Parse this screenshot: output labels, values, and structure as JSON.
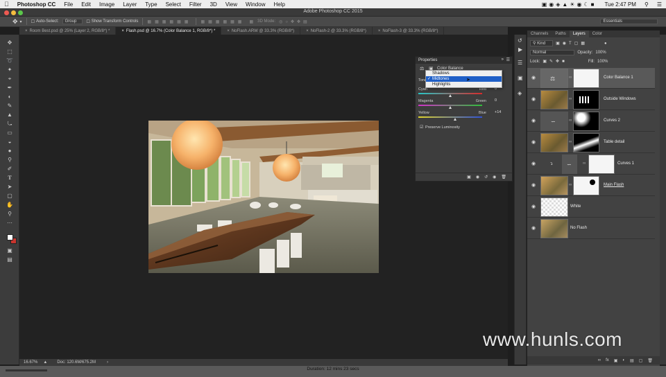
{
  "menubar": {
    "app_name": "Photoshop CC",
    "items": [
      "File",
      "Edit",
      "Image",
      "Layer",
      "Type",
      "Select",
      "Filter",
      "3D",
      "View",
      "Window",
      "Help"
    ],
    "clock": "Tue 2:47 PM"
  },
  "window_title": "Adobe Photoshop CC 2015",
  "options_bar": {
    "auto_select_label": "Auto-Select:",
    "auto_select_value": "Group",
    "show_transform_label": "Show Transform Controls",
    "mode_3d_label": "3D Mode:",
    "workspace": "Essentials"
  },
  "doc_tabs": [
    {
      "label": "Room Best.psd @ 25% (Layer 2, RGB/8*) *",
      "active": false
    },
    {
      "label": "Flash.psd @ 16.7% (Color Balance 1, RGB/8*) *",
      "active": true
    },
    {
      "label": "NoFlash.ARW @ 33.3% (RGB/8*)",
      "active": false
    },
    {
      "label": "NoFlash-2 @ 33.3% (RGB/8*)",
      "active": false
    },
    {
      "label": "NoFlash-3 @ 33.3% (RGB/8*)",
      "active": false
    }
  ],
  "status_bar": {
    "zoom": "16.67%",
    "doc_size": "Doc: 120.6M/675.2M"
  },
  "footer": {
    "duration": "Duration: 12 mins 23 secs"
  },
  "properties": {
    "panel_title": "Properties",
    "adjustment_title": "Color Balance",
    "tone_label": "Tone:",
    "tone_options": [
      "Shadows",
      "Midtones",
      "Highlights"
    ],
    "tone_selected": "Midtones",
    "sliders": [
      {
        "left": "Cyan",
        "right": "Red",
        "value": "0",
        "fraction": 0.5
      },
      {
        "left": "Magenta",
        "right": "Green",
        "value": "0",
        "fraction": 0.5
      },
      {
        "left": "Yellow",
        "right": "Blue",
        "value": "+14",
        "fraction": 0.57
      }
    ],
    "preserve_luminosity_label": "Preserve Luminosity",
    "preserve_luminosity_checked": true
  },
  "layers_panel": {
    "tabs": [
      "Channels",
      "Paths",
      "Layers",
      "Color"
    ],
    "active_tab": "Layers",
    "filter_kind": "Kind",
    "blend_mode": "Normal",
    "opacity_label": "Opacity:",
    "opacity_value": "100%",
    "lock_label": "Lock:",
    "fill_label": "Fill:",
    "fill_value": "100%",
    "layers": [
      {
        "name": "Color Balance 1",
        "kind": "adjustment",
        "selected": true
      },
      {
        "name": "Outside Windows",
        "kind": "masked-photo",
        "selected": false
      },
      {
        "name": "Curves 2",
        "kind": "adjustment-mask",
        "selected": false
      },
      {
        "name": "Table detail",
        "kind": "masked-photo",
        "selected": false
      },
      {
        "name": "Curves 1",
        "kind": "adjustment",
        "selected": false
      },
      {
        "name": "Main Flash",
        "kind": "masked-photo",
        "selected": false
      },
      {
        "name": "White",
        "kind": "transparent",
        "selected": false
      },
      {
        "name": "No Flash",
        "kind": "photo",
        "selected": false
      }
    ]
  },
  "watermark": "www.hunls.com",
  "colors": {
    "selection_blue": "#1f5fc7",
    "foreground_swatch": "#ffffff",
    "background_swatch": "#c8352e"
  }
}
